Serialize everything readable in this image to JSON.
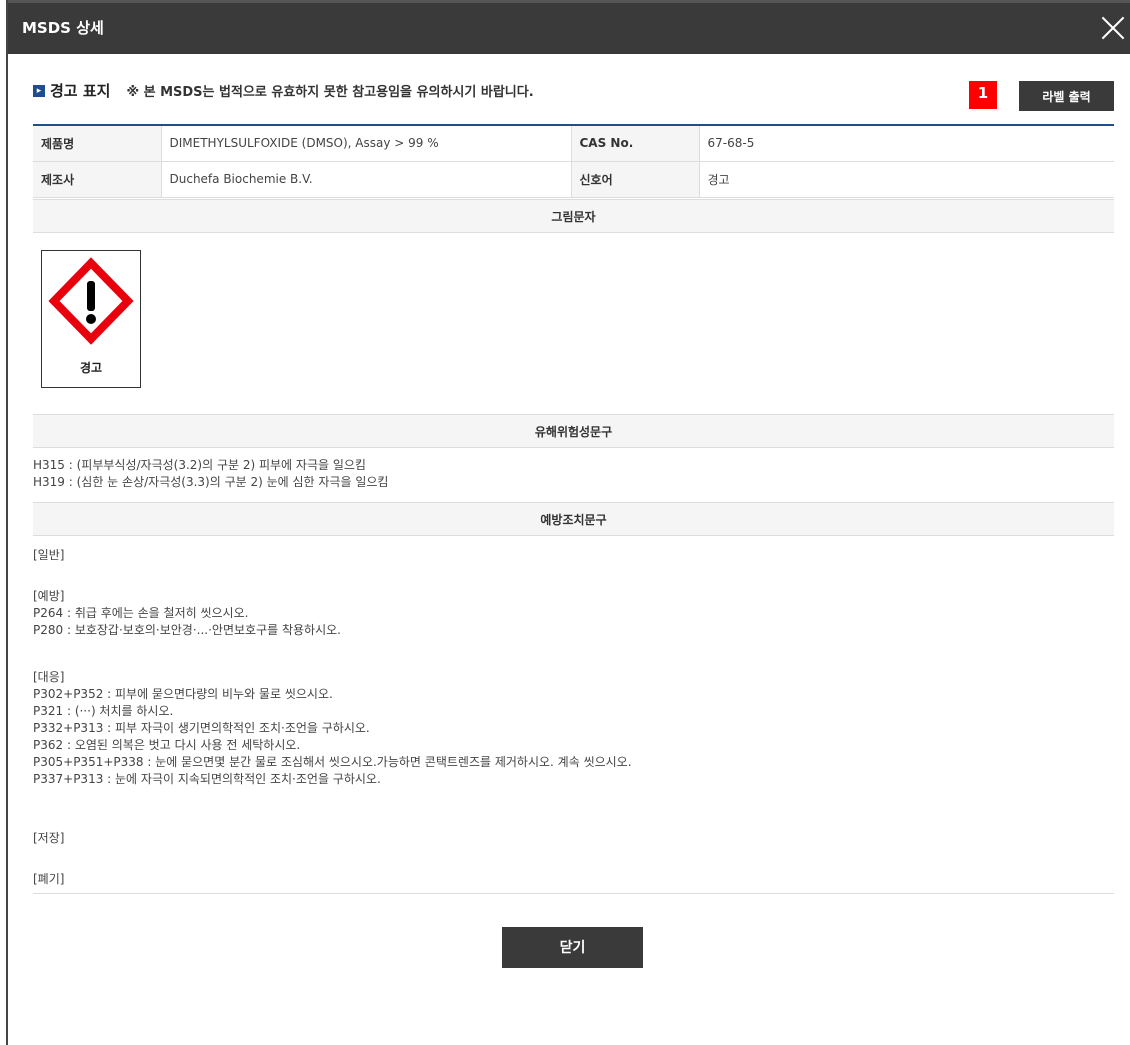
{
  "modal": {
    "title": "MSDS 상세",
    "close_icon": "close-icon"
  },
  "header": {
    "bullet_icon": "arrow-bullet-icon",
    "section_title": "경고 표지",
    "notice": "※ 본 MSDS는 법적으로 유효하지 못한 참고용임을 유의하시기 바랍니다.",
    "badge": "1",
    "label_print_button": "라벨 출력"
  },
  "info": {
    "product_name_label": "제품명",
    "product_name_value": "DIMETHYLSULFOXIDE (DMSO), Assay > 99 %",
    "cas_label": "CAS No.",
    "cas_value": "67-68-5",
    "manufacturer_label": "제조사",
    "manufacturer_value": "Duchefa Biochemie B.V.",
    "signal_word_label": "신호어",
    "signal_word_value": "경고"
  },
  "pictograms": {
    "heading": "그림문자",
    "items": [
      {
        "icon": "exclamation-mark-pictogram-icon",
        "caption": "경고"
      }
    ]
  },
  "hazard_statements": {
    "heading": "유해위험성문구",
    "lines": [
      "H315 : (피부부식성/자극성(3.2)의 구분 2) 피부에 자극을 일으킴",
      "H319 : (심한 눈 손상/자극성(3.3)의 구분 2) 눈에 심한 자극을 일으킴"
    ]
  },
  "precautionary_statements": {
    "heading": "예방조치문구",
    "general": "[일반]",
    "prevention": {
      "label": "[예방]",
      "lines": [
        "P264 : 취급 후에는 손을 철저히 씻으시오.",
        "P280 : 보호장갑·보호의·보안경·...·안면보호구를 착용하시오."
      ]
    },
    "response": {
      "label": "[대응]",
      "lines": [
        "P302+P352 : 피부에 묻으면다량의 비누와 물로 씻으시오.",
        "P321 : (···) 처치를 하시오.",
        "P332+P313 : 피부 자극이 생기면의학적인 조치·조언을 구하시오.",
        "P362 : 오염된 의복은 벗고 다시 사용 전 세탁하시오.",
        "P305+P351+P338 : 눈에 묻으면몇 분간 물로 조심해서 씻으시오.가능하면 콘택트렌즈를 제거하시오. 계속 씻으시오.",
        "P337+P313 : 눈에 자극이 지속되면의학적인 조치·조언을 구하시오."
      ]
    },
    "storage": "[저장]",
    "disposal": "[폐기]"
  },
  "footer": {
    "close_button": "닫기"
  }
}
